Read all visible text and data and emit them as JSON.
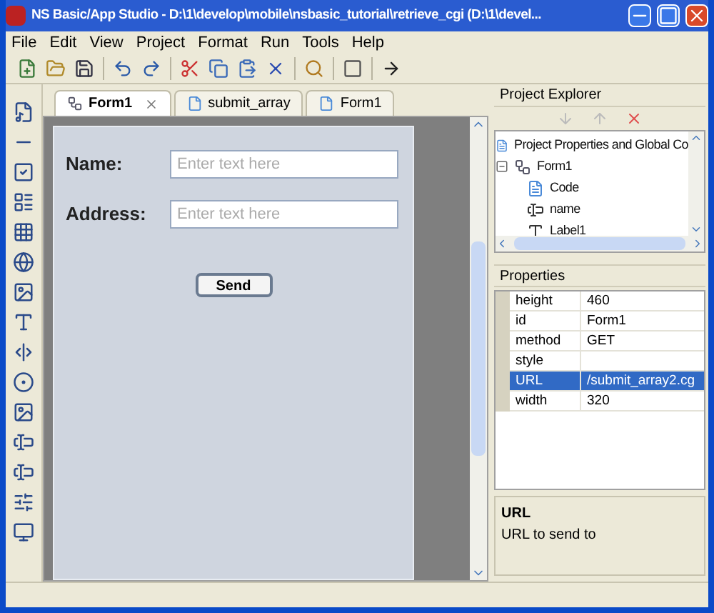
{
  "window": {
    "title": "NS Basic/App Studio - D:\\1\\develop\\mobile\\nsbasic_tutorial\\retrieve_cgi (D:\\1\\devel..."
  },
  "menu": [
    "File",
    "Edit",
    "View",
    "Project",
    "Format",
    "Run",
    "Tools",
    "Help"
  ],
  "tabs": [
    {
      "label": "Form1",
      "selected": true,
      "kind": "form",
      "closable": true
    },
    {
      "label": "submit_array",
      "selected": false,
      "kind": "file",
      "closable": false
    },
    {
      "label": "Form1",
      "selected": false,
      "kind": "file",
      "closable": false
    }
  ],
  "form": {
    "fields": [
      {
        "label": "Name:",
        "placeholder": "Enter text here"
      },
      {
        "label": "Address:",
        "placeholder": "Enter text here"
      }
    ],
    "button": "Send"
  },
  "project_explorer": {
    "title": "Project Explorer",
    "tree": [
      {
        "label": "Project Properties and Global Co",
        "kind": "page"
      },
      {
        "label": "Form1",
        "kind": "form",
        "expanded": true,
        "children": [
          {
            "label": "Code",
            "kind": "page"
          },
          {
            "label": "name",
            "kind": "input"
          },
          {
            "label": "Label1",
            "kind": "label"
          }
        ]
      }
    ]
  },
  "properties": {
    "title": "Properties",
    "rows": [
      {
        "name": "height",
        "value": "460",
        "selected": false
      },
      {
        "name": "id",
        "value": "Form1",
        "selected": false
      },
      {
        "name": "method",
        "value": "GET",
        "selected": false
      },
      {
        "name": "style",
        "selected": false
      },
      {
        "name": "URL",
        "value": "/submit_array2.cg",
        "selected": true
      },
      {
        "name": "width",
        "value": "320",
        "selected": false
      }
    ],
    "description": {
      "title": "URL",
      "text": "URL to send to"
    }
  }
}
